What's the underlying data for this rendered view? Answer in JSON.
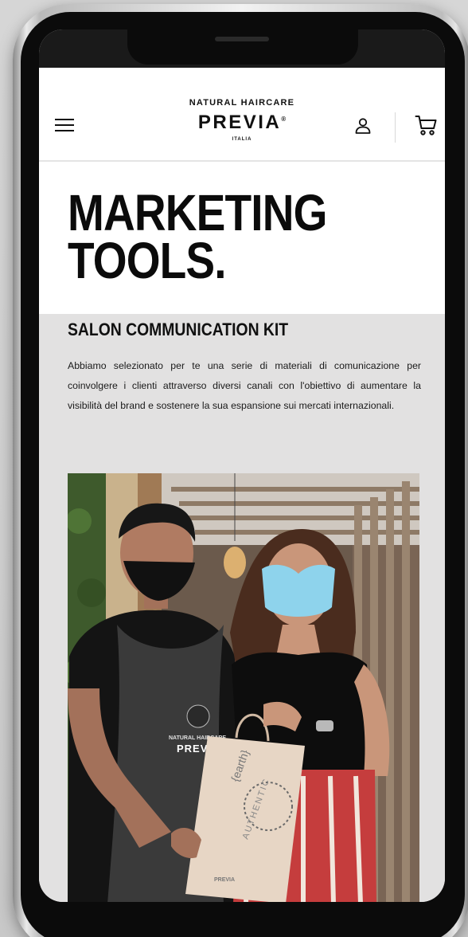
{
  "header": {
    "logo_tagline": "NATURAL HAIRCARE",
    "logo_brand": "PREVIA",
    "logo_mark": "®",
    "logo_country": "ITALIA"
  },
  "page": {
    "title_line1": "MARKETING",
    "title_line2": "TOOLS.",
    "section_heading": "SALON COMMUNICATION KIT",
    "intro_text": "Abbiamo selezionato per te una serie di materiali di comunicazione per coinvolgere i clienti attraverso diversi canali con l'obiettivo di aumentare la visibilità del brand e sostenere la sua espansione sui mercati internazionali."
  },
  "photo": {
    "apron_text_top": "NATURAL HAIRCARE",
    "apron_text_brand": "PREVIA",
    "bag_text_1": "{earth}",
    "bag_text_2": "AUTHENTIC",
    "bag_text_3": "PREVIA"
  },
  "colors": {
    "accent": "#111111",
    "section_bg": "#e2e1e1",
    "header_bg": "#ffffff"
  },
  "icons": {
    "menu": "hamburger-icon",
    "account": "user-icon",
    "cart": "cart-icon"
  }
}
